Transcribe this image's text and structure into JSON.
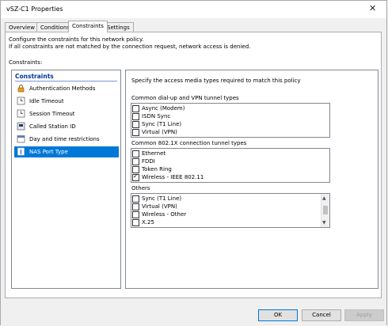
{
  "window": {
    "title": "vSZ-C1 Properties",
    "close_glyph": "✕"
  },
  "tabs": [
    {
      "label": "Overview"
    },
    {
      "label": "Conditions"
    },
    {
      "label": "Constraints"
    },
    {
      "label": "Settings"
    }
  ],
  "active_tab": "Constraints",
  "intro": {
    "line1": "Configure the constraints for this network policy.",
    "line2": "If all constraints are not matched by the connection request, network access is denied."
  },
  "constraints_label": "Constraints:",
  "sidebar": {
    "header": "Constraints",
    "items": [
      {
        "label": "Authentication Methods",
        "icon": "lock-icon"
      },
      {
        "label": "Idle Timeout",
        "icon": "clock-icon"
      },
      {
        "label": "Session Timeout",
        "icon": "clock-icon"
      },
      {
        "label": "Called Station ID",
        "icon": "phone-id-icon"
      },
      {
        "label": "Day and time restrictions",
        "icon": "calendar-icon"
      },
      {
        "label": "NAS Port Type",
        "icon": "info-icon",
        "selected": true
      }
    ]
  },
  "detail": {
    "instruction": "Specify the access media types required to match this policy",
    "dialup_label": "Common dial-up and VPN tunnel types",
    "dialup_items": [
      {
        "label": "Async (Modem)",
        "checked": false
      },
      {
        "label": "ISDN Sync",
        "checked": false
      },
      {
        "label": "Sync (T1 Line)",
        "checked": false
      },
      {
        "label": "Virtual (VPN)",
        "checked": false
      }
    ],
    "dot1x_label": "Common 802.1X connection tunnel types",
    "dot1x_items": [
      {
        "label": "Ethernet",
        "checked": false
      },
      {
        "label": "FDDI",
        "checked": false
      },
      {
        "label": "Token Ring",
        "checked": false
      },
      {
        "label": "Wireless - IEEE 802.11",
        "checked": true
      }
    ],
    "others_label": "Others",
    "others_items": [
      {
        "label": "Sync (T1 Line)",
        "checked": false
      },
      {
        "label": "Virtual (VPN)",
        "checked": false
      },
      {
        "label": "Wireless - Other",
        "checked": false
      },
      {
        "label": "X.25",
        "checked": false
      }
    ]
  },
  "buttons": {
    "ok": "OK",
    "cancel": "Cancel",
    "apply": "Apply"
  },
  "colors": {
    "selection": "#0078d7",
    "header_text": "#003399"
  }
}
